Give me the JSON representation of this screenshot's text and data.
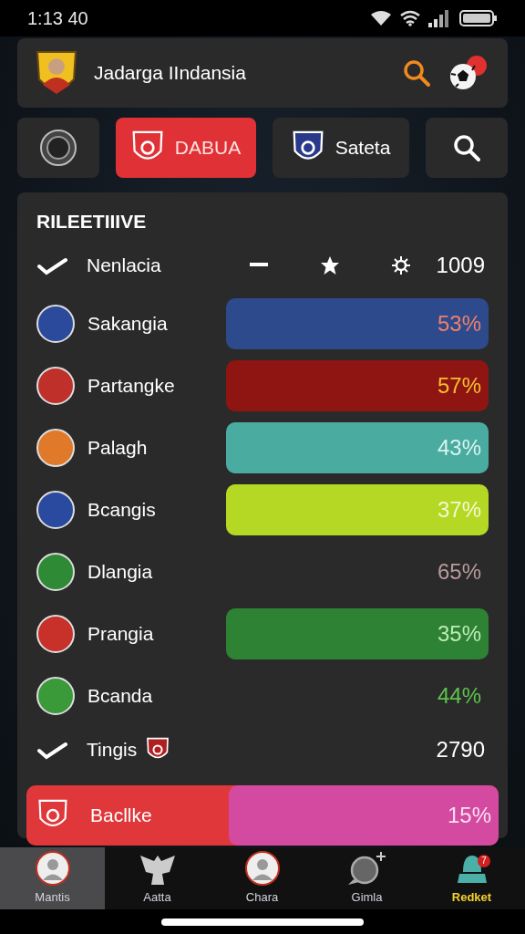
{
  "status_bar": {
    "time": "1:13 40"
  },
  "header": {
    "title": "Jadarga IIndansia"
  },
  "tabs": [
    {
      "kind": "crest",
      "selected": false
    },
    {
      "kind": "crest",
      "label": "DABUA",
      "selected": true
    },
    {
      "kind": "crest",
      "label": "Sateta",
      "selected": false
    },
    {
      "kind": "search",
      "selected": false
    }
  ],
  "panel": {
    "title": "RILEETIIIVE",
    "rows": [
      {
        "kind": "header",
        "name": "Nenlacia",
        "value": "1009"
      },
      {
        "kind": "bar",
        "name": "Sakangia",
        "color": "#2b4a9c",
        "bar": {
          "color": "#2d4a8c"
        },
        "percent": {
          "text": "53%",
          "color": "#f0806a"
        }
      },
      {
        "kind": "bar",
        "name": "Partangke",
        "color": "#c0302a",
        "bar": {
          "color": "#8e1512"
        },
        "percent": {
          "text": "57%",
          "color": "#f5c030"
        }
      },
      {
        "kind": "bar",
        "name": "Palagh",
        "color": "#e07a2a",
        "bar": {
          "color": "#4aaba0"
        },
        "percent": {
          "text": "43%",
          "color": "#d8f4f0"
        }
      },
      {
        "kind": "bar",
        "name": "Bcangis",
        "color": "#2a4aa0",
        "bar": {
          "color": "#b4d824"
        },
        "percent": {
          "text": "37%",
          "color": "#f4f8d0"
        }
      },
      {
        "kind": "plain",
        "name": "Dlangia",
        "color": "#2e8a34",
        "percent": {
          "text": "65%",
          "color": "#b89a9a"
        }
      },
      {
        "kind": "bar",
        "name": "Prangia",
        "color": "#c8302a",
        "bar": {
          "color": "#2e8234"
        },
        "percent": {
          "text": "35%",
          "color": "#bfeab8"
        }
      },
      {
        "kind": "plain",
        "name": "Bcanda",
        "color": "#3a9a3a",
        "percent": {
          "text": "44%",
          "color": "#5cc44a"
        }
      },
      {
        "kind": "footer",
        "name": "Tingis",
        "value": "2790"
      },
      {
        "kind": "highlight",
        "name": "Bacllke",
        "color": "#e0383a",
        "bar": {
          "color": "#d44aa0"
        },
        "percent": {
          "text": "15%",
          "color": "#f8e0f0"
        }
      }
    ]
  },
  "bottom_nav": [
    {
      "label": "Mantis",
      "selected": true,
      "kind": "avatar"
    },
    {
      "label": "Aatta",
      "selected": false,
      "kind": "eagle"
    },
    {
      "label": "Chara",
      "selected": false,
      "kind": "avatar"
    },
    {
      "label": "Gimla",
      "selected": false,
      "kind": "chat"
    },
    {
      "label": "Redket",
      "selected": false,
      "kind": "hat",
      "badge": "7"
    }
  ]
}
